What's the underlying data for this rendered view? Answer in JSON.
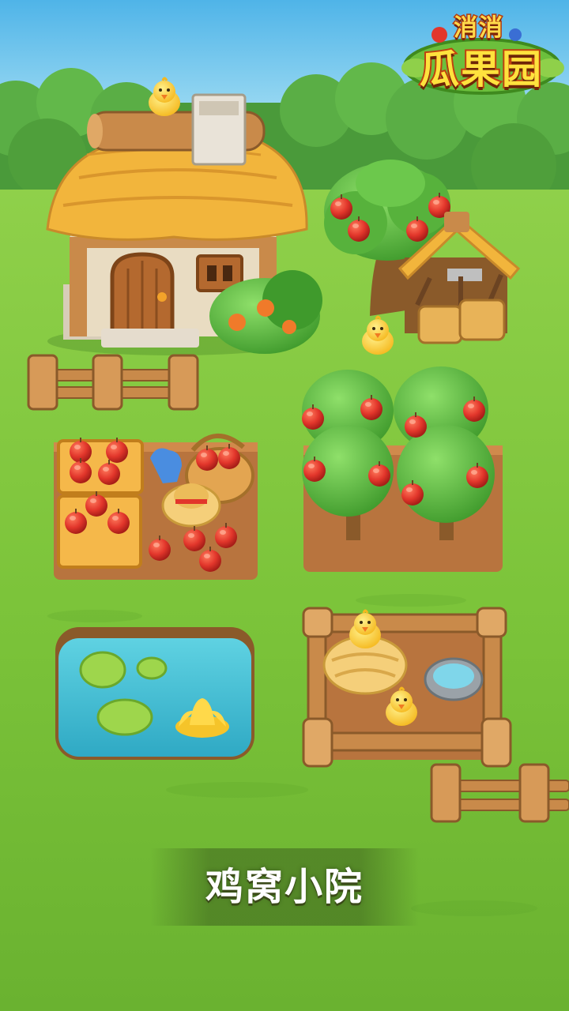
{
  "logo": {
    "line1": "消消",
    "line2": "瓜果园"
  },
  "scene_title": "鸡窝小院",
  "colors": {
    "sky": "#6cc3ee",
    "grass": "#7cc43a",
    "soil": "#b8743e",
    "wood": "#c98a4a",
    "thatch": "#f2b53c",
    "apple": "#e2362b",
    "chick": "#ffd33a",
    "water": "#41c2d6",
    "logo_text": "#ffe23d",
    "logo_outline": "#c0410f"
  },
  "icons": [
    "chick-icon",
    "apple-icon",
    "lily-pad-icon",
    "lotus-icon",
    "tool-icon"
  ]
}
